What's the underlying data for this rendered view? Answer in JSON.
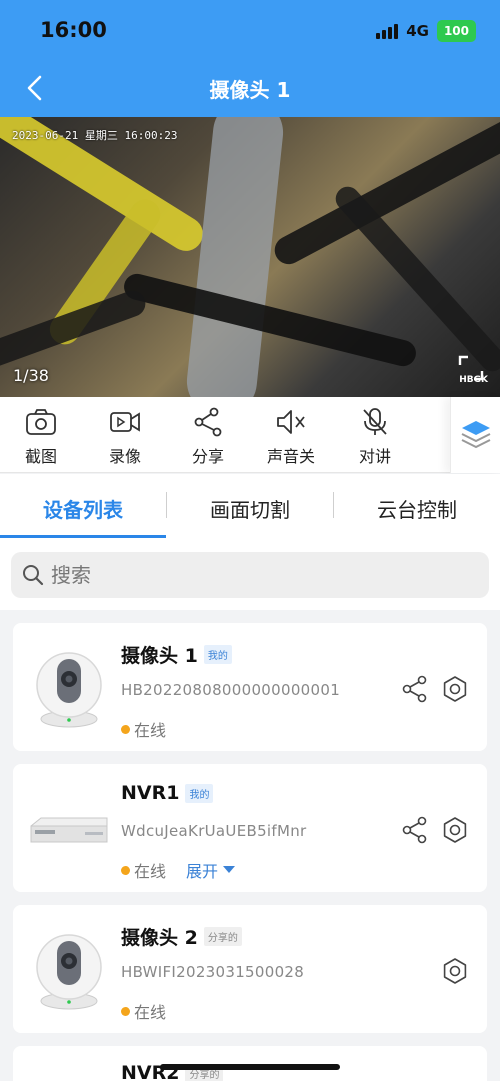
{
  "status": {
    "time": "16:00",
    "network": "4G",
    "battery": "100"
  },
  "header": {
    "title": "摄像头 1"
  },
  "video": {
    "osd": "2023-06-21  星期三  16:00:23",
    "page_counter": "1/38",
    "watermark": "HBGK"
  },
  "toolbar": {
    "items": [
      {
        "label": "截图",
        "icon": "camera-icon"
      },
      {
        "label": "录像",
        "icon": "video-record-icon"
      },
      {
        "label": "分享",
        "icon": "share-icon"
      },
      {
        "label": "声音关",
        "icon": "mute-icon"
      },
      {
        "label": "对讲",
        "icon": "mic-off-icon"
      }
    ],
    "more_icon": "layers-icon"
  },
  "tabs": [
    "设备列表",
    "画面切割",
    "云台控制"
  ],
  "search": {
    "placeholder": "搜索"
  },
  "devices": [
    {
      "name": "摄像头 1",
      "tag": "我的",
      "sn": "HB20220808000000000001",
      "status": "在线",
      "type": "camera"
    },
    {
      "name": "NVR1",
      "tag": "我的",
      "sn": "WdcuJeaKrUaUEB5ifMnr",
      "status": "在线",
      "expand": "展开",
      "type": "nvr"
    },
    {
      "name": "摄像头 2",
      "tag": "分享的",
      "sn": "HBWIFI2023031500028",
      "status": "在线",
      "type": "camera"
    },
    {
      "name": "NVR2",
      "tag": "分享的",
      "type": "nvr"
    }
  ],
  "colors": {
    "accent": "#3d9cf4",
    "tab_active": "#2a86e8",
    "online": "#f4a51c"
  }
}
